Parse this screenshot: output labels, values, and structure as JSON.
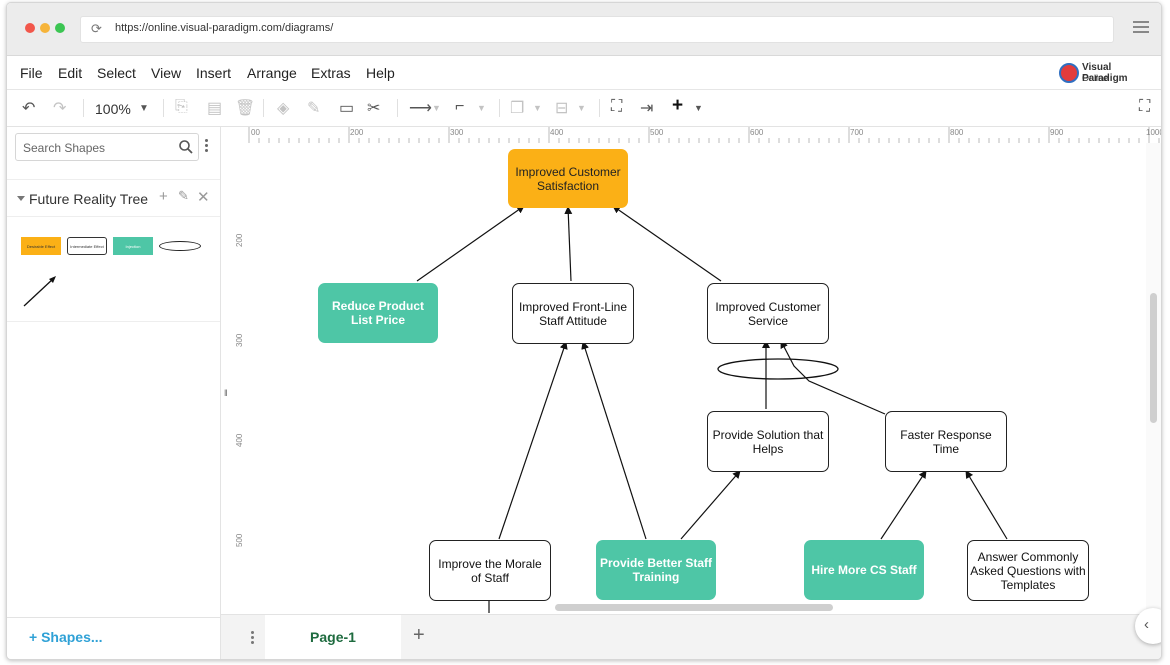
{
  "browser": {
    "url": "https://online.visual-paradigm.com/diagrams/",
    "dots": [
      "#f2574b",
      "#f6b43a",
      "#3bc552"
    ]
  },
  "menu": {
    "items": [
      "File",
      "Edit",
      "Select",
      "View",
      "Insert",
      "Arrange",
      "Extras",
      "Help"
    ],
    "brand_line1": "Visual Paradigm",
    "brand_line2": "Online"
  },
  "toolbar": {
    "zoom": "100%"
  },
  "left_panel": {
    "search_placeholder": "Search Shapes",
    "library_name": "Future Reality Tree",
    "thumbnails": [
      "Desirable Effect",
      "Intermediate Effect",
      "Injection"
    ],
    "more_shapes": "Shapes..."
  },
  "rulers": {
    "horizontal": [
      "00",
      "200",
      "300",
      "400",
      "500",
      "600",
      "700",
      "800",
      "900",
      "1000"
    ],
    "vertical": [
      "200",
      "300",
      "400",
      "500"
    ]
  },
  "diagram": {
    "nodes": [
      {
        "id": "n1",
        "text": "Improved Customer Satisfaction",
        "style": "orange"
      },
      {
        "id": "n2",
        "text": "Reduce Product List Price",
        "style": "teal"
      },
      {
        "id": "n3",
        "text": "Improved Front-Line Staff Attitude",
        "style": "out"
      },
      {
        "id": "n4",
        "text": "Improved Customer Service",
        "style": "out"
      },
      {
        "id": "n5",
        "text": "Provide Solution that Helps",
        "style": "out"
      },
      {
        "id": "n6",
        "text": "Faster Response Time",
        "style": "out"
      },
      {
        "id": "n7",
        "text": "Improve the Morale of Staff",
        "style": "out"
      },
      {
        "id": "n8",
        "text": "Provide Better Staff Training",
        "style": "teal"
      },
      {
        "id": "n9",
        "text": "Hire More CS Staff",
        "style": "teal"
      },
      {
        "id": "n10",
        "text": "Answer Commonly Asked Questions with Templates",
        "style": "out"
      }
    ],
    "colors": {
      "orange": "#fbb016",
      "teal": "#4ec6a6"
    }
  },
  "pages": {
    "tabs": [
      "Page-1"
    ]
  }
}
